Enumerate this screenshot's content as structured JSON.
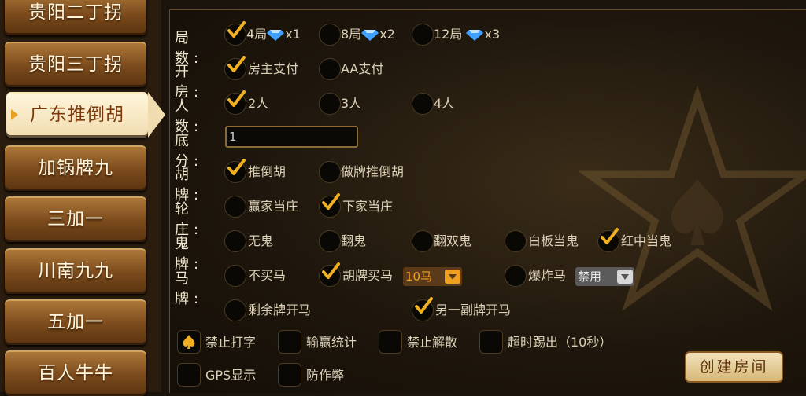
{
  "sidebar": {
    "items": [
      {
        "label": "贵阳二丁拐"
      },
      {
        "label": "贵阳三丁拐"
      },
      {
        "label": "广东推倒胡"
      },
      {
        "label": "加锅牌九"
      },
      {
        "label": "三加一"
      },
      {
        "label": "川南九九"
      },
      {
        "label": "五加一"
      },
      {
        "label": "百人牛牛"
      }
    ],
    "active_index": 2
  },
  "form": {
    "rounds": {
      "label": "局 数:",
      "options": [
        {
          "label": "4局",
          "gem": "x1",
          "checked": true
        },
        {
          "label": "8局",
          "gem": "x2",
          "checked": false
        },
        {
          "label": "12局",
          "gem": "x3",
          "checked": false
        }
      ]
    },
    "room": {
      "label": "开 房:",
      "options": [
        {
          "label": "房主支付",
          "checked": true
        },
        {
          "label": "AA支付",
          "checked": false
        }
      ]
    },
    "players": {
      "label": "人 数:",
      "options": [
        {
          "label": "2人",
          "checked": true
        },
        {
          "label": "3人",
          "checked": false
        },
        {
          "label": "4人",
          "checked": false
        }
      ]
    },
    "base": {
      "label": "底 分:",
      "value": "1"
    },
    "hu": {
      "label": "胡 牌:",
      "options": [
        {
          "label": "推倒胡",
          "checked": true
        },
        {
          "label": "做牌推倒胡",
          "checked": false
        }
      ]
    },
    "dealer": {
      "label": "轮 庄:",
      "options": [
        {
          "label": "赢家当庄",
          "checked": false
        },
        {
          "label": "下家当庄",
          "checked": true
        }
      ]
    },
    "ghost": {
      "label": "鬼 牌:",
      "options": [
        {
          "label": "无鬼",
          "checked": false
        },
        {
          "label": "翻鬼",
          "checked": false
        },
        {
          "label": "翻双鬼",
          "checked": false
        },
        {
          "label": "白板当鬼",
          "checked": false
        },
        {
          "label": "红中当鬼",
          "checked": true
        }
      ]
    },
    "horse": {
      "label": "马 牌:",
      "options": [
        {
          "label": "不买马",
          "checked": false
        },
        {
          "label": "胡牌买马",
          "checked": true
        },
        {
          "label": "爆炸马",
          "checked": false
        }
      ],
      "buy_select": "10马",
      "bomb_select": "禁用",
      "row2": [
        {
          "label": "剩余牌开马",
          "checked": false
        },
        {
          "label": "另一副牌开马",
          "checked": true
        }
      ]
    },
    "extras": [
      {
        "label": "禁止打字",
        "checked": true
      },
      {
        "label": "输赢统计",
        "checked": false
      },
      {
        "label": "禁止解散",
        "checked": false
      },
      {
        "label": "超时踢出（10秒）",
        "checked": false
      },
      {
        "label": "GPS显示",
        "checked": false
      },
      {
        "label": "防作弊",
        "checked": false
      }
    ]
  },
  "create_button": "创建房间",
  "icons": {
    "gem": "diamond-icon",
    "check": "checkmark-icon",
    "spade": "spade-icon"
  },
  "colors": {
    "accent": "#e8a020",
    "check": "#f0b020"
  }
}
